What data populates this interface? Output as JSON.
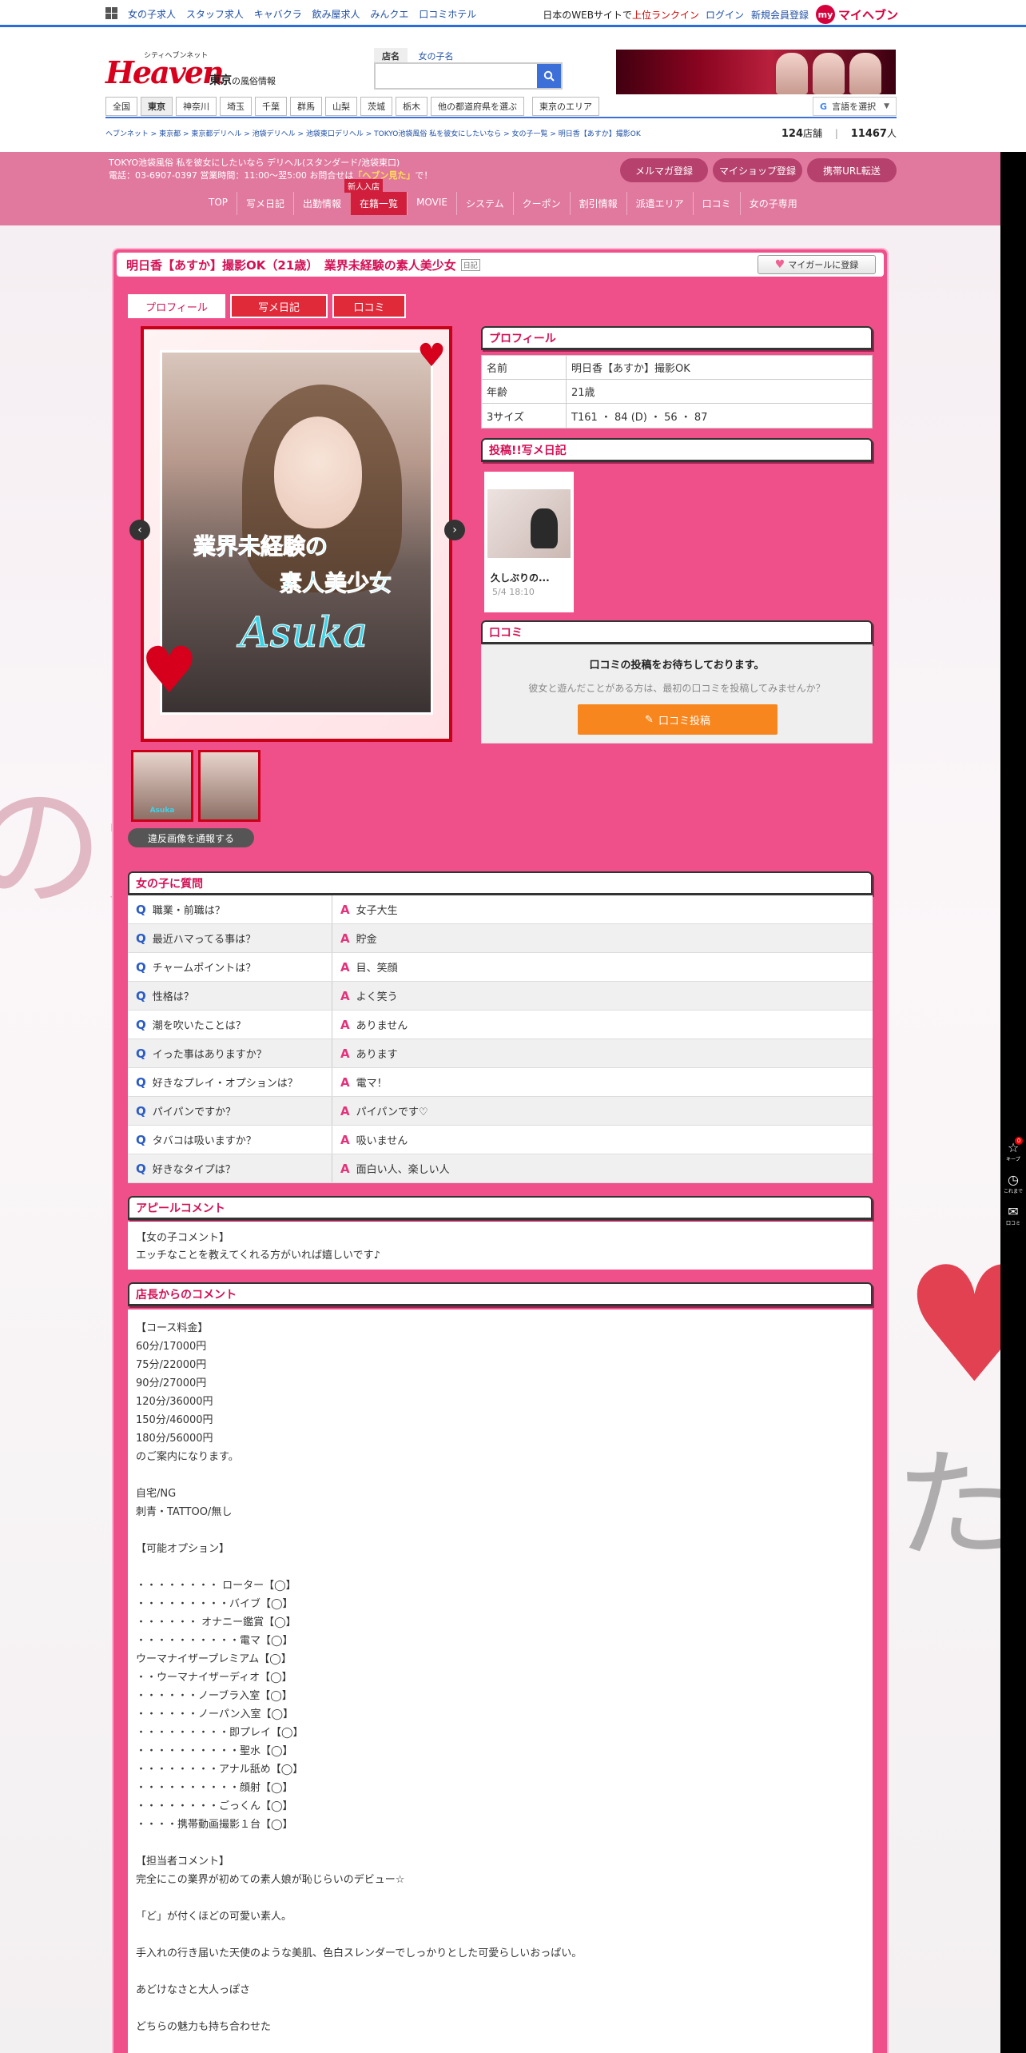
{
  "topbar": {
    "links": [
      "女の子求人",
      "スタッフ求人",
      "キャバクラ",
      "飲み屋求人",
      "みんクエ",
      "口コミホテル"
    ],
    "rank_prefix": "日本のWEBサイトで",
    "rank_highlight": "上位ランクイン",
    "login": "ログイン",
    "register": "新規会員登録",
    "my_badge": "my",
    "my_label": "マイヘブン"
  },
  "header": {
    "logo_small": "シティヘブンネット",
    "logo_main": "Heaven",
    "region": "東京",
    "region_suffix": "の風俗情報",
    "search_tab_shop": "店名",
    "search_tab_girl": "女の子名",
    "search_value": "",
    "areas": [
      "全国",
      "東京",
      "神奈川",
      "埼玉",
      "千葉",
      "群馬",
      "山梨",
      "茨城",
      "栃木",
      "他の都道府県を選ぶ",
      "東京のエリア"
    ],
    "lang_g": "G",
    "lang_label": "言語を選択",
    "lang_arrow": "▼",
    "breadcrumb": "ヘブンネット > 東京都 > 東京都デリヘル > 池袋デリヘル > 池袋東口デリヘル > TOKYO池袋風俗 私を彼女にしたいなら > 女の子一覧 > 明日香【あすか】撮影OK",
    "shop_count": "124",
    "shop_unit": "店舗",
    "girl_count": "11467",
    "girl_unit": "人"
  },
  "shop": {
    "line1": "TOKYO池袋風俗 私を彼女にしたいなら デリヘル(スタンダード/池袋東口)",
    "line2_prefix": "電話：03-6907-0397 営業時間：11:00〜翌5:00 お問合せは",
    "line2_highlight": "「ヘブン見た」",
    "line2_suffix": "で！",
    "btn_mail": "メルマガ登録",
    "btn_myshop": "マイショップ登録",
    "btn_mobile": "携帯URL転送",
    "nav": [
      "TOP",
      "写メ日記",
      "出勤情報",
      "在籍一覧",
      "MOVIE",
      "システム",
      "クーポン",
      "割引情報",
      "派遣エリア",
      "口コミ",
      "女の子専用"
    ],
    "new_tag": "新人入店"
  },
  "girl": {
    "title": "明日香【あすか】撮影OK（21歳）　業界未経験の素人美少女",
    "diary_tag": "日記",
    "mygirl_btn": "マイガールに登録",
    "tabs": [
      "プロフィール",
      "写メ日記",
      "口コミ"
    ],
    "photo_caption1": "業界未経験の",
    "photo_caption2": "素人美少女",
    "photo_caption3": "Asuka",
    "thumb_caption": "Asuka",
    "report_btn": "違反画像を通報する",
    "profile_head": "プロフィール",
    "profile": [
      {
        "k": "名前",
        "v": "明日香【あすか】撮影OK"
      },
      {
        "k": "年齢",
        "v": "21歳"
      },
      {
        "k": "3サイズ",
        "v": "T161 ・ 84 (D) ・ 56 ・ 87"
      }
    ],
    "diary_head": "投稿!!写メ日記",
    "diary_title": "久しぶりの...",
    "diary_date": "5/4 18:10",
    "review_head": "口コミ",
    "review_msg1": "口コミの投稿をお待ちしております。",
    "review_msg2": "彼女と遊んだことがある方は、最初の口コミを投稿してみませんか？",
    "review_btn": "口コミ投稿",
    "qa_head": "女の子に質問",
    "qa": [
      {
        "q": "職業・前職は？",
        "a": "女子大生"
      },
      {
        "q": "最近ハマってる事は？",
        "a": "貯金"
      },
      {
        "q": "チャームポイントは？",
        "a": "目、笑顔"
      },
      {
        "q": "性格は？",
        "a": "よく笑う"
      },
      {
        "q": "潮を吹いたことは？",
        "a": "ありません"
      },
      {
        "q": "イった事はありますか？",
        "a": "あります"
      },
      {
        "q": "好きなプレイ・オプションは？",
        "a": "電マ！"
      },
      {
        "q": "パイパンですか？",
        "a": "パイパンです♡"
      },
      {
        "q": "タバコは吸いますか？",
        "a": "吸いません"
      },
      {
        "q": "好きなタイプは？",
        "a": "面白い人、楽しい人"
      }
    ],
    "appeal_head": "アピールコメント",
    "appeal_text": "【女の子コメント】\nエッチなことを教えてくれる方がいれば嬉しいです♪",
    "comment_head": "店長からのコメント",
    "comment_text": "【コース料金】\n60分/17000円\n75分/22000円\n90分/27000円\n120分/36000円\n150分/46000円\n180分/56000円\nのご案内になります。\n\n自宅/NG\n刺青・TATTOO/無し\n\n【可能オプション】\n\n・・・・・・・・ ローター【◯】\n・・・・・・・・・バイブ【◯】\n・・・・・・ オナニー鑑賞【◯】\n・・・・・・・・・・電マ【◯】\nウーマナイザープレミアム【◯】\n・・ウーマナイザーディオ【◯】\n・・・・・・ノーブラ入室【◯】\n・・・・・・ノーパン入室【◯】\n・・・・・・・・・即プレイ【◯】\n・・・・・・・・・・聖水【◯】\n・・・・・・・・アナル舐め【◯】\n・・・・・・・・・・顔射【◯】\n・・・・・・・・ごっくん【◯】\n・・・・携帯動画撮影１台【◯】\n\n【担当者コメント】\n完全にこの業界が初めての素人娘が恥じらいのデビュー☆\n\n「ど」が付くほどの可愛い素人。\n\n手入れの行き届いた天使のような美肌、色白スレンダーでしっかりとした可愛らしいおっぱい。\n\nあどけなさと大人っぽさ\n\nどちらの魅力も持ち合わせた"
  },
  "side_tools": [
    {
      "icon": "☆",
      "label": "キープ",
      "badge": "0"
    },
    {
      "icon": "◷",
      "label": "これまで"
    },
    {
      "icon": "✉",
      "label": "口コミ"
    }
  ],
  "background_text": [
    "の素人と",
    "た"
  ]
}
